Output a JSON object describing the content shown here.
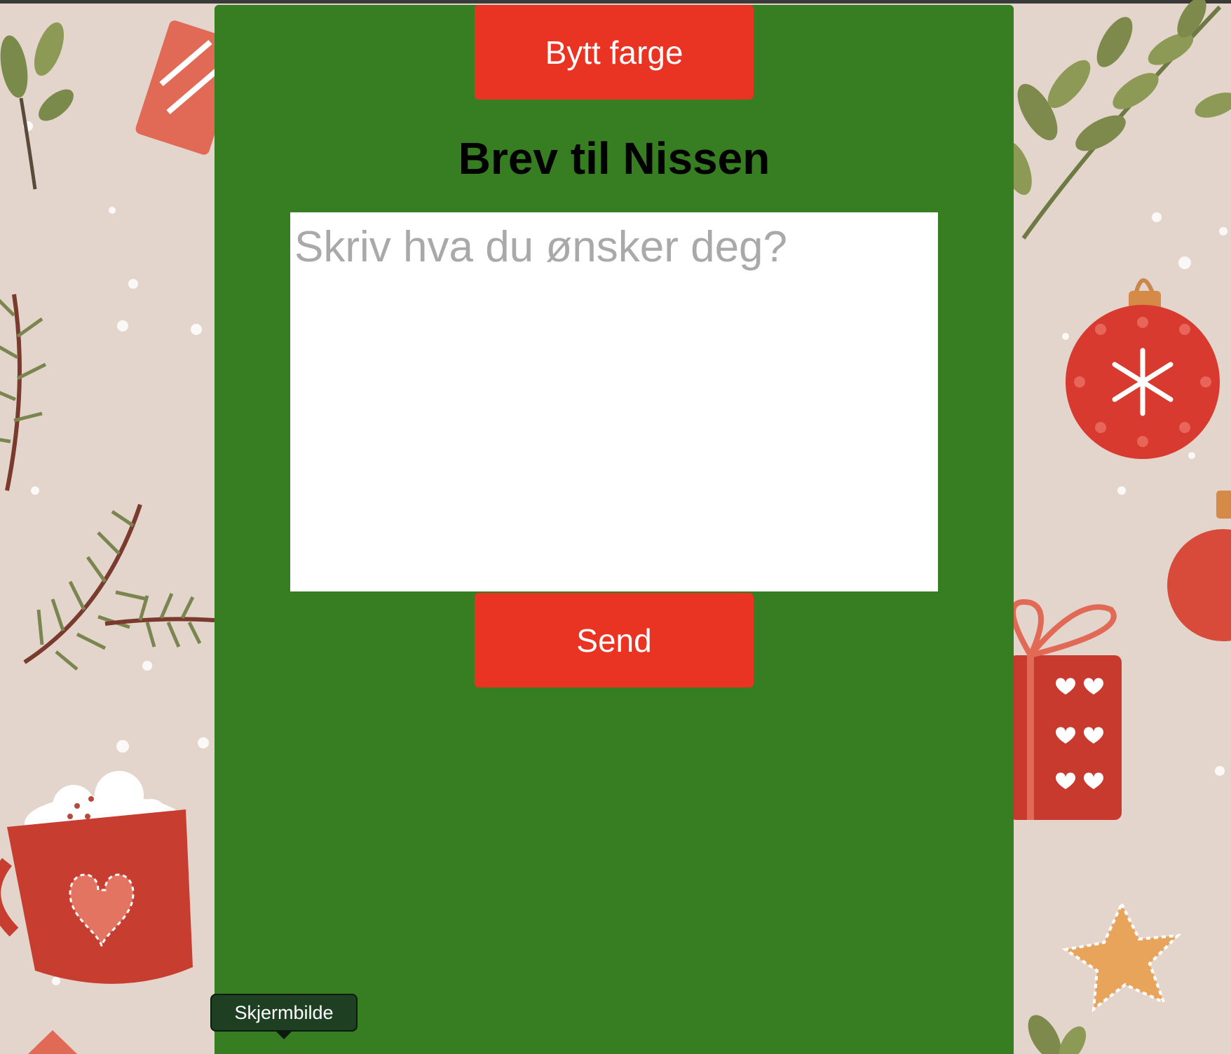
{
  "header": {
    "change_color_label": "Bytt farge",
    "title": "Brev til Nissen"
  },
  "letter": {
    "placeholder": "Skriv hva du ønsker deg?",
    "value": ""
  },
  "actions": {
    "send_label": "Send"
  },
  "tooltip": {
    "label": "Skjermbilde"
  },
  "colors": {
    "panel": "#377e22",
    "button": "#e93323",
    "background": "#e3d5cc"
  },
  "decor": {
    "left": [
      "mistletoe-icon",
      "gift-icon",
      "pine-branch-icon",
      "cocoa-mug-icon"
    ],
    "right": [
      "leaf-branch-icon",
      "ornament-icon",
      "gift-icon",
      "star-cookie-icon"
    ]
  }
}
